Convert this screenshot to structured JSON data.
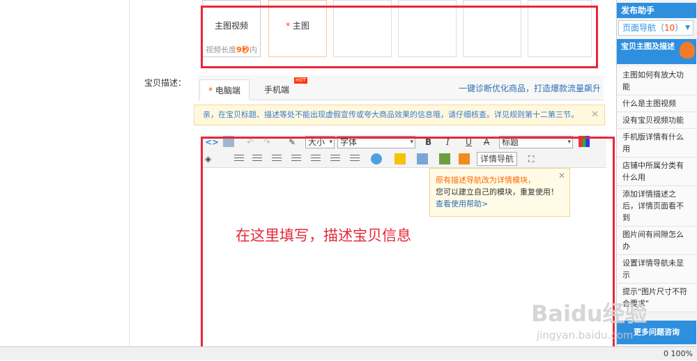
{
  "media": {
    "slot1_label": "主图视频",
    "slot1_sub_pre": "视频长度",
    "slot1_sub_val": "9秒",
    "slot1_sub_post": "内",
    "slot2_star": "*",
    "slot2_label": "主图"
  },
  "description": {
    "label": "宝贝描述：",
    "tab_pc_star": "*",
    "tab_pc": "电脑端",
    "tab_mobile": "手机端",
    "hot_badge": "HOT",
    "diagnose_link": "一键诊断优化商品，打造爆款流量飙升"
  },
  "notice": {
    "text": "亲，在宝贝标题、描述等处不能出现虚假宣传或夸大商品效果的信息哦，请仔细核查。详见规则第十二第三节。",
    "close": "✕"
  },
  "toolbar": {
    "size_select": "大小",
    "font_select": "字体",
    "bold": "B",
    "italic": "I",
    "underline": "U",
    "strike": "A",
    "heading_select": "标题",
    "detail_nav_button": "详情导航",
    "redo": "↷",
    "undo": "↶"
  },
  "popup": {
    "line1": "原有描述导航改为详情模块，",
    "line2": "您可以建立自己的模块，重复使用！",
    "link": "查看使用帮助>",
    "close": "✕"
  },
  "editor": {
    "overlay_text": "在这里填写，描述宝贝信息"
  },
  "helper": {
    "title": "发布助手",
    "nav_label": "页面导航（",
    "nav_count": "10",
    "nav_close": "）",
    "section": "宝贝主图及描述",
    "items": [
      "主图如何有放大功能",
      "什么是主图视频",
      "没有宝贝视频功能",
      "手机版详情有什么用",
      "店铺中所属分类有什么用",
      "添加详情描述之后，详情页面看不到",
      "图片间有间隙怎么办",
      "设置详情导航未显示",
      "提示\"图片尺寸不符合要求\""
    ],
    "more": "更多问题咨询"
  },
  "status": {
    "right": "0  100%"
  },
  "watermark": {
    "brand": "Baidu经验",
    "url": "jingyan.baidu.com"
  },
  "colors": {
    "accent_blue": "#2f8fdf",
    "annotation_red": "#e5283a",
    "warning_orange": "#ff6600"
  }
}
